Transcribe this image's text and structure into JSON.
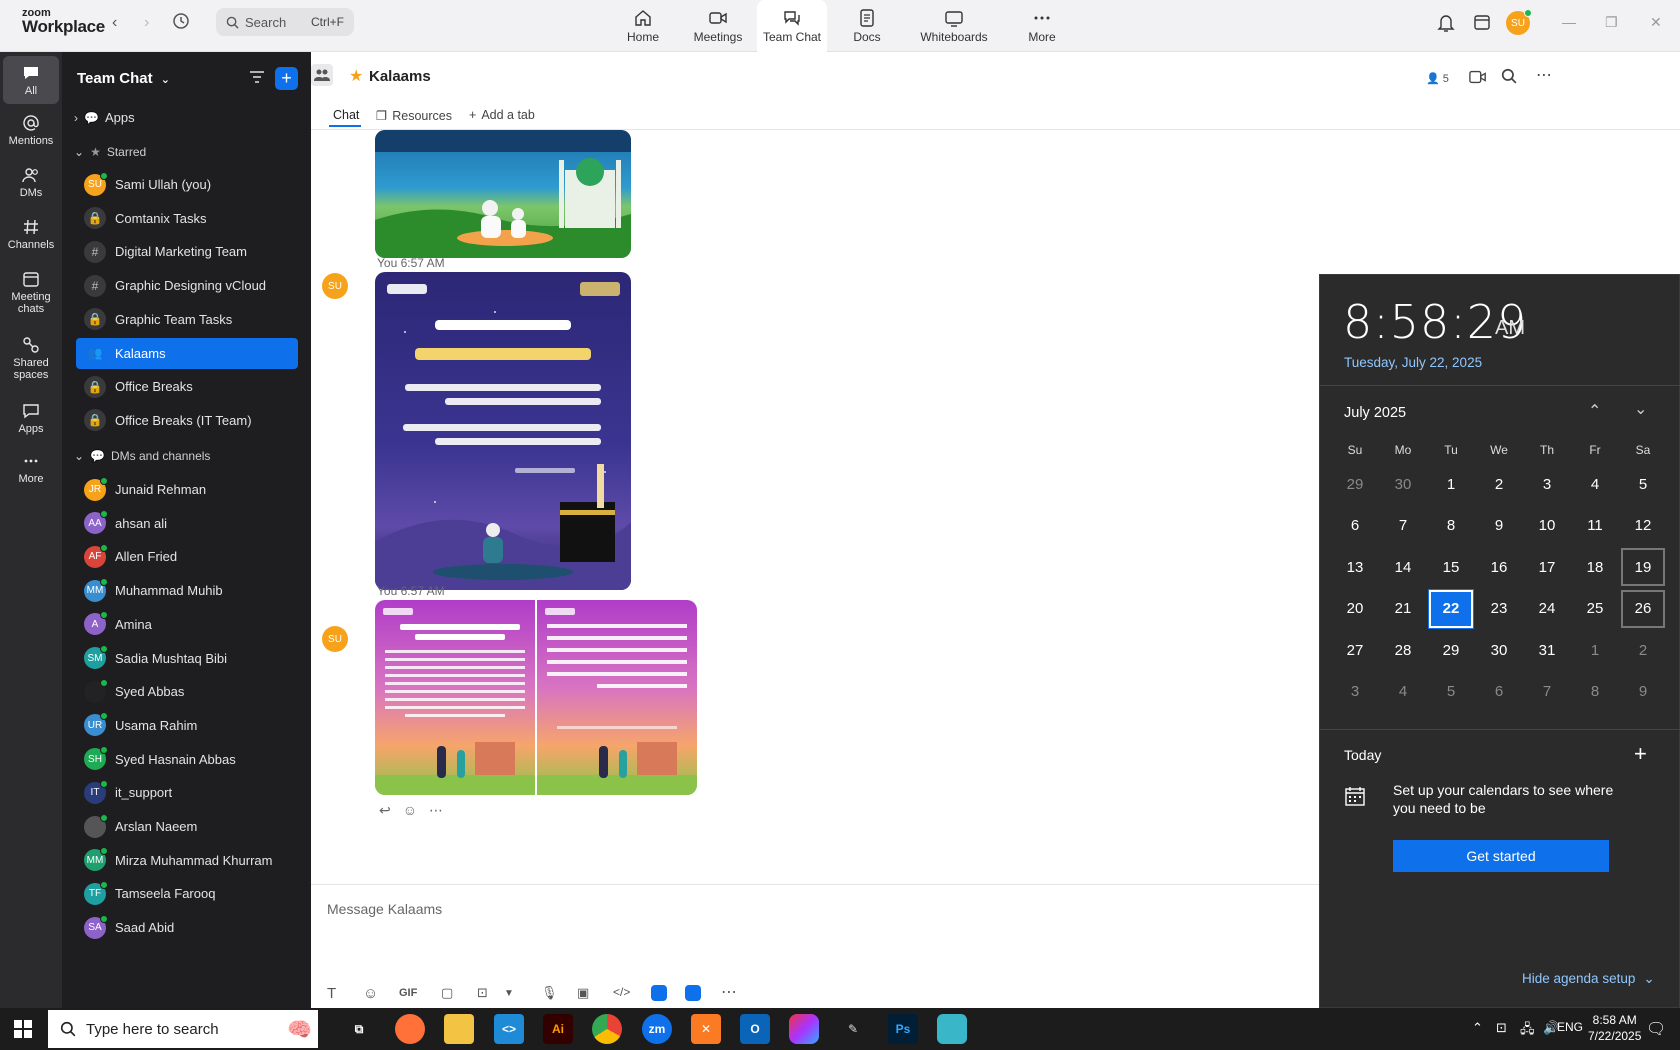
{
  "app": {
    "brand_line1": "zoom",
    "brand_line2": "Workplace"
  },
  "search": {
    "placeholder": "Search",
    "shortcut": "Ctrl+F"
  },
  "top_tabs": [
    {
      "label": "Home"
    },
    {
      "label": "Meetings"
    },
    {
      "label": "Team Chat"
    },
    {
      "label": "Docs"
    },
    {
      "label": "Whiteboards"
    },
    {
      "label": "More"
    }
  ],
  "profile": {
    "initials": "SU"
  },
  "rail": [
    {
      "label": "All"
    },
    {
      "label": "Mentions"
    },
    {
      "label": "DMs"
    },
    {
      "label": "Channels"
    },
    {
      "label": "Meeting chats"
    },
    {
      "label": "Shared spaces"
    },
    {
      "label": "Apps"
    },
    {
      "label": "More"
    }
  ],
  "sidebar": {
    "title": "Team Chat",
    "sections": {
      "apps": "Apps",
      "starred": "Starred",
      "dms": "DMs and channels"
    },
    "starred": [
      {
        "label": "Sami Ullah (you)",
        "initials": "SU",
        "color": "#f7a21b"
      },
      {
        "label": "Comtanix Tasks",
        "glyph": "🔒"
      },
      {
        "label": "Digital Marketing Team",
        "glyph": "#"
      },
      {
        "label": "Graphic Designing vCloud",
        "glyph": "#"
      },
      {
        "label": "Graphic Team Tasks",
        "glyph": "🔒"
      },
      {
        "label": "Kalaams",
        "glyph": "👥"
      },
      {
        "label": "Office Breaks",
        "glyph": "🔒"
      },
      {
        "label": "Office Breaks (IT Team)",
        "glyph": "🔒"
      }
    ],
    "dms": [
      {
        "label": "Junaid Rehman",
        "initials": "JR",
        "color": "#f7a21b"
      },
      {
        "label": "ahsan ali",
        "initials": "AA",
        "color": "#8e63c9"
      },
      {
        "label": "Allen Fried",
        "initials": "AF",
        "color": "#d9453b"
      },
      {
        "label": "Muhammad Muhib",
        "initials": "MM",
        "color": "#3a8ed0"
      },
      {
        "label": "Amina",
        "initials": "A",
        "color": "#8e63c9"
      },
      {
        "label": "Sadia Mushtaq Bibi",
        "initials": "SM",
        "color": "#1e9fa0"
      },
      {
        "label": "Syed Abbas",
        "initials": "",
        "color": "#222"
      },
      {
        "label": "Usama Rahim",
        "initials": "UR",
        "color": "#3a8ed0"
      },
      {
        "label": "Syed Hasnain Abbas",
        "initials": "SH",
        "color": "#1faa55"
      },
      {
        "label": "it_support",
        "initials": "IT",
        "color": "#2a3d7a"
      },
      {
        "label": "Arslan Naeem",
        "initials": "",
        "color": "#555"
      },
      {
        "label": "Mirza Muhammad Khurram",
        "initials": "MM",
        "color": "#1e9f70"
      },
      {
        "label": "Tamseela Farooq",
        "initials": "TF",
        "color": "#1e9fa0"
      },
      {
        "label": "Saad Abid",
        "initials": "SA",
        "color": "#8e63c9"
      }
    ]
  },
  "chat": {
    "title": "Kalaams",
    "member_count": "5",
    "tabs": [
      "Chat",
      "Resources",
      "Add a tab"
    ],
    "messages": [
      {
        "sender_initials": "SU",
        "meta": "You 6:57 AM"
      },
      {
        "sender_initials": "SU",
        "meta": "You 6:57 AM"
      }
    ],
    "composer_placeholder": "Message Kalaams"
  },
  "calendar": {
    "time": "8:58:29",
    "ampm": "AM",
    "date": "Tuesday, July 22, 2025",
    "month_label": "July 2025",
    "weekdays": [
      "Su",
      "Mo",
      "Tu",
      "We",
      "Th",
      "Fr",
      "Sa"
    ],
    "weeks": [
      [
        "29",
        "30",
        "1",
        "2",
        "3",
        "4",
        "5"
      ],
      [
        "6",
        "7",
        "8",
        "9",
        "10",
        "11",
        "12"
      ],
      [
        "13",
        "14",
        "15",
        "16",
        "17",
        "18",
        "19"
      ],
      [
        "20",
        "21",
        "22",
        "23",
        "24",
        "25",
        "26"
      ],
      [
        "27",
        "28",
        "29",
        "30",
        "31",
        "1",
        "2"
      ],
      [
        "3",
        "4",
        "5",
        "6",
        "7",
        "8",
        "9"
      ]
    ],
    "today": "22",
    "today_label": "Today",
    "agenda_text": "Set up your calendars to see where you need to be",
    "get_started": "Get started",
    "hide_agenda": "Hide agenda setup"
  },
  "taskbar": {
    "search_placeholder": "Type here to search",
    "time": "8:58 AM",
    "date": "7/22/2025"
  },
  "colors": {
    "accent": "#0e71eb",
    "sidebar_bg": "#1e1e20",
    "rail_bg": "#2b2b2e"
  }
}
